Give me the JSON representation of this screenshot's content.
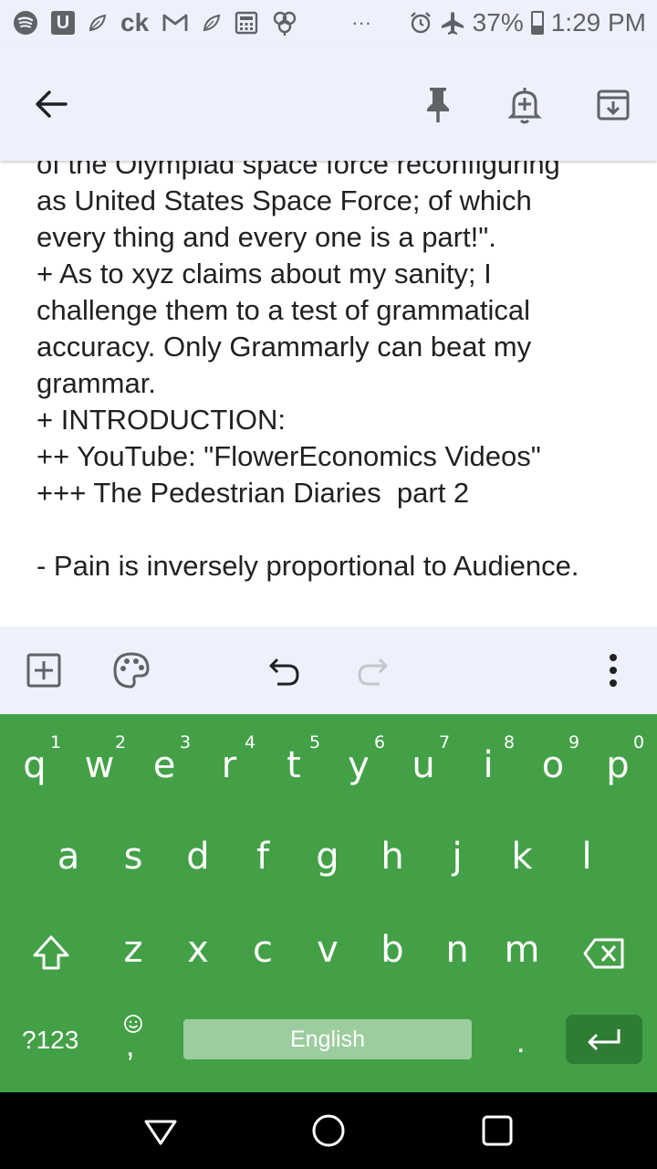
{
  "status_bar": {
    "u_badge": "U",
    "ck_text": "ck",
    "dots": "···",
    "battery": "37%",
    "battery_level": 0.37,
    "time": "1:29 PM",
    "icons": [
      "spotify-icon",
      "u-app-icon",
      "leaf-icon",
      "ck-icon",
      "gmail-icon",
      "leaf-icon",
      "calculator-icon",
      "pinwheel-icon",
      "alarm-icon",
      "airplane-icon",
      "battery-icon"
    ]
  },
  "toolbar": {
    "back_icon": "back-arrow-icon",
    "pin_icon": "pin-icon",
    "reminder_icon": "add-reminder-icon",
    "archive_icon": "archive-icon"
  },
  "note": {
    "lines": [
      "of the Olympiad space force reconfiguring",
      "as United States Space Force; of which",
      "every thing and every one is a part!\".",
      "+ As to xyz claims about my sanity; I",
      "challenge them to a test of grammatical",
      "accuracy. Only Grammarly can beat my",
      "grammar.",
      "+ INTRODUCTION:",
      "++ YouTube: \"FlowerEconomics Videos\"",
      "+++ The Pedestrian Diaries  part 2",
      "",
      "- Pain is inversely proportional to Audience."
    ]
  },
  "editor_bar": {
    "add_icon": "add-box-icon",
    "palette_icon": "palette-icon",
    "undo_icon": "undo-icon",
    "redo_icon": "redo-icon",
    "more_icon": "more-vert-icon"
  },
  "keyboard": {
    "row1": [
      "q",
      "w",
      "e",
      "r",
      "t",
      "y",
      "u",
      "i",
      "o",
      "p"
    ],
    "row1_hints": [
      "1",
      "2",
      "3",
      "4",
      "5",
      "6",
      "7",
      "8",
      "9",
      "0"
    ],
    "row2": [
      "a",
      "s",
      "d",
      "f",
      "g",
      "h",
      "j",
      "k",
      "l"
    ],
    "row3": [
      "z",
      "x",
      "c",
      "v",
      "b",
      "n",
      "m"
    ],
    "symbols_label": "?123",
    "comma": ",",
    "space_label": "English",
    "period": ".",
    "accent_color": "#43a047",
    "enter_color": "#2e7d32"
  },
  "navbar": {
    "back_icon": "nav-back-icon",
    "home_icon": "nav-home-icon",
    "recents_icon": "nav-recents-icon"
  }
}
